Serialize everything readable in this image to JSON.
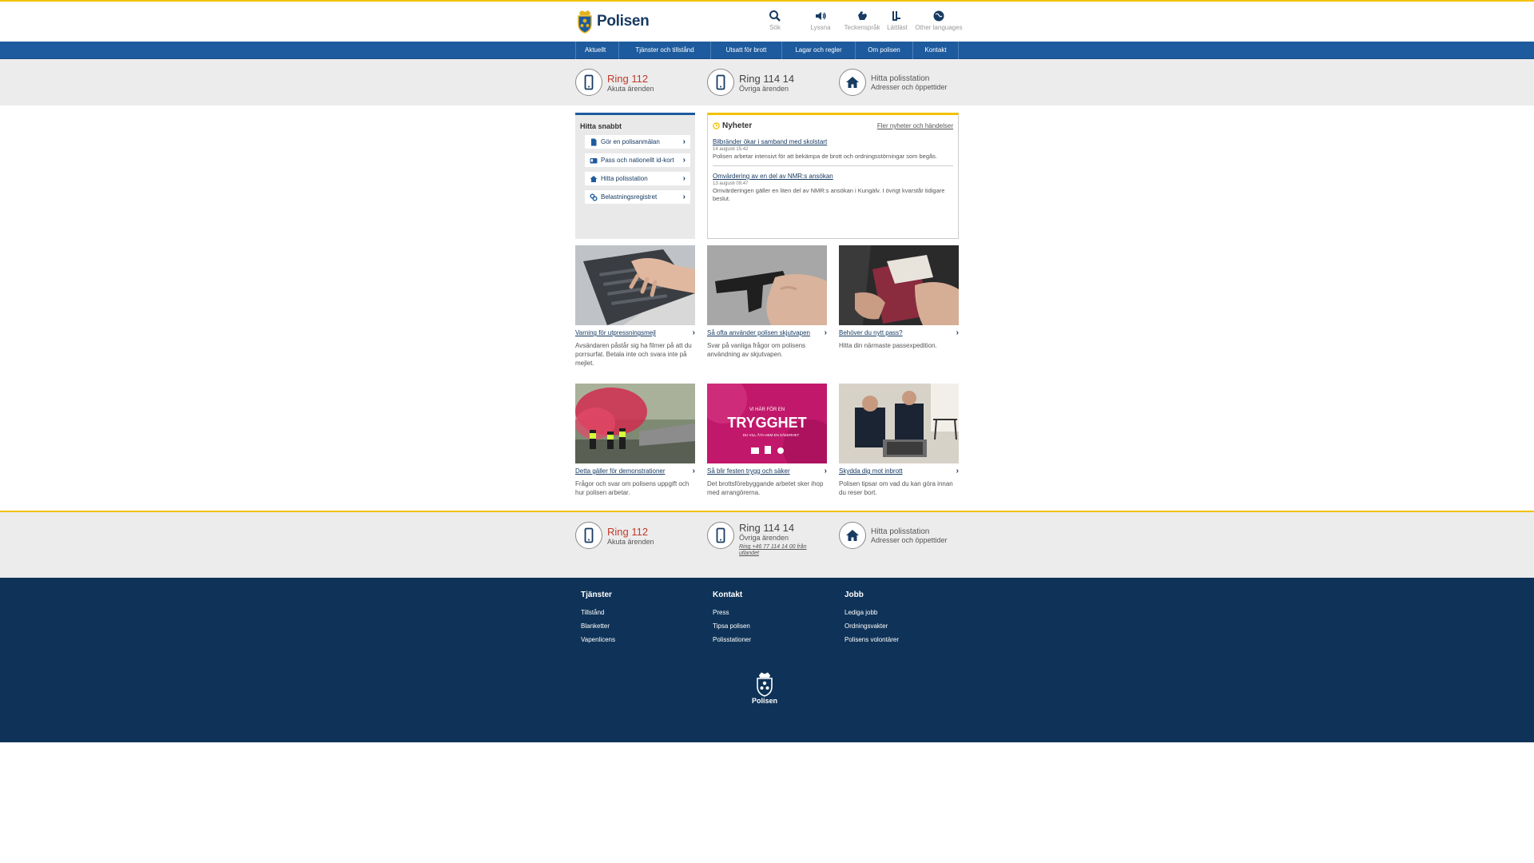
{
  "brand": {
    "name": "Polisen",
    "accent": "#f2c100",
    "nav_blue": "#1e5b9e",
    "footer_blue": "#0f3358"
  },
  "tools": [
    {
      "label": "Sök",
      "icon": "search-icon"
    },
    {
      "label": "Lyssna",
      "icon": "speaker-icon"
    },
    {
      "label": "Teckenspråk",
      "icon": "hand-icon"
    },
    {
      "label": "Lättläst",
      "icon": "ll-icon"
    },
    {
      "label": "Other languages",
      "icon": "globe-icon"
    }
  ],
  "nav": [
    "Aktuellt",
    "Tjänster och tillstånd",
    "Utsatt för brott",
    "Lagar och regler",
    "Om polisen",
    "Kontakt"
  ],
  "calls": {
    "emergency": {
      "title": "Ring 112",
      "sub": "Akuta ärenden"
    },
    "other": {
      "title": "Ring 114 14",
      "sub": "Övriga ärenden",
      "abroad": "Ring +46 77 114 14 00 från utlandet"
    },
    "station": {
      "title": "Hitta polisstation",
      "sub": "Adresser och öppettider"
    }
  },
  "quick": {
    "title": "Hitta snabbt",
    "links": [
      "Gör en polisanmälan",
      "Pass och nationellt id-kort",
      "Hitta polisstation",
      "Belastningsregistret"
    ]
  },
  "news": {
    "title": "Nyheter",
    "more": "Fler nyheter och händelser",
    "items": [
      {
        "title": "Bilbränder ökar i samband med skolstart",
        "date": "14 augusti 15.42",
        "text": "Polisen arbetar intensivt för att bekämpa de brott och ordningsstörningar som begås."
      },
      {
        "title": "Omvärdering av en del av NMR:s ansökan",
        "date": "13 augusti 09.47",
        "text": "Omvärderingen gäller en liten del av NMR:s ansökan i Kungälv. I övrigt kvarstår tidigare beslut."
      }
    ]
  },
  "cards": [
    {
      "title": "Varning för utpressningsmejl",
      "desc": "Avsändaren påstår sig ha filmer på att du porrsurfat. Betala inte och svara inte på mejlet."
    },
    {
      "title": "Så ofta använder polisen skjutvapen",
      "desc": "Svar på vanliga frågor om polisens användning av skjutvapen."
    },
    {
      "title": "Behöver du nytt pass?",
      "desc": "Hitta din närmaste passexpedition."
    },
    {
      "title": "Detta gäller för demonstrationer",
      "desc": "Frågor och svar om polisens uppgift och hur polisen arbetar."
    },
    {
      "title": "Så blir festen trygg och säker",
      "desc": "Det brottsförebyggande arbetet sker ihop med arrangörerna."
    },
    {
      "title": "Skydda dig mot inbrott",
      "desc": "Polisen tipsar om vad du kan göra innan du reser bort."
    }
  ],
  "poster": {
    "line1": "VI HÄR FÖR EN",
    "big": "TRYGGHET",
    "line2": "DU VILL ÅTA HEM EN SÄKERHET"
  },
  "footer": {
    "cols": [
      {
        "title": "Tjänster",
        "links": [
          "Tillstånd",
          "Blanketter",
          "Vapenlicens"
        ]
      },
      {
        "title": "Kontakt",
        "links": [
          "Press",
          "Tipsa polisen",
          "Polisstationer"
        ]
      },
      {
        "title": "Jobb",
        "links": [
          "Lediga jobb",
          "Ordningsvakter",
          "Polisens volontärer"
        ]
      }
    ],
    "logo": "Polisen"
  }
}
